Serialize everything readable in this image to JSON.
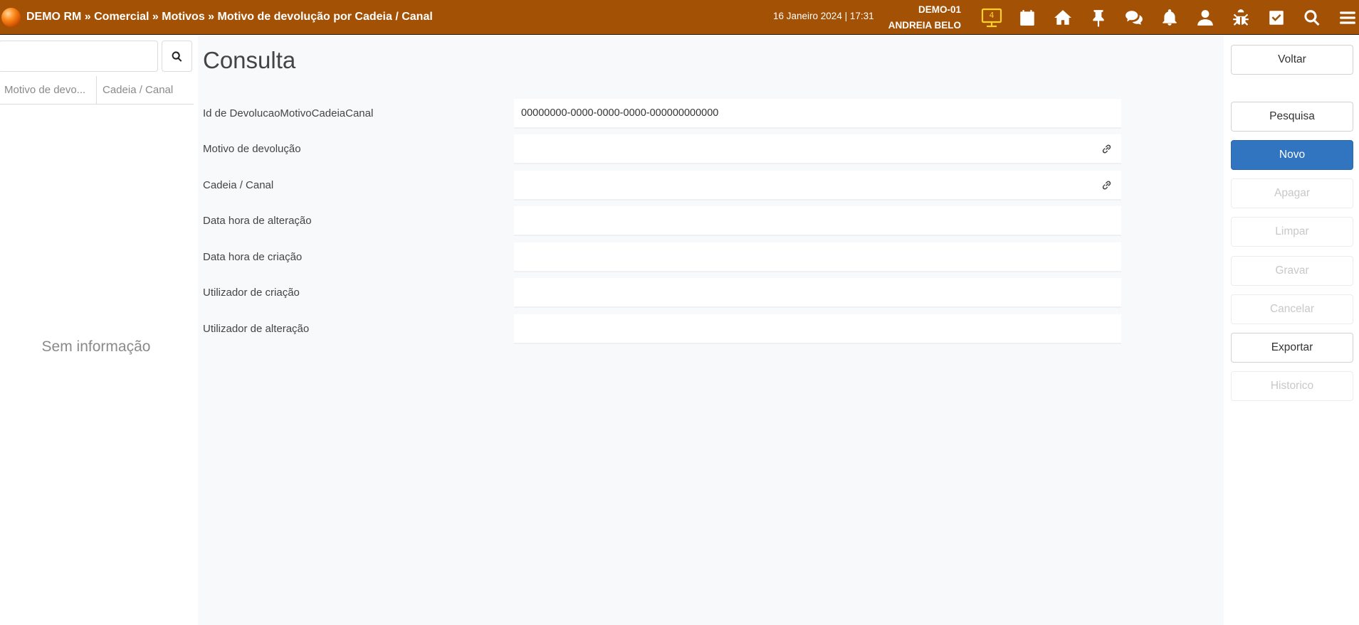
{
  "topbar": {
    "breadcrumb": "DEMO RM » Comercial » Motivos » Motivo de devolução por Cadeia / Canal",
    "datetime": "16 Janeiro 2024 | 17:31",
    "company": "DEMO-01",
    "user": "ANDREIA BELO",
    "monitor_count": "4",
    "icon_color_highlight": "#ffcf2e",
    "bar_color": "#a35104"
  },
  "left": {
    "columns": [
      "Motivo de devo...",
      "Cadeia / Canal"
    ],
    "empty_message": "Sem informação"
  },
  "main": {
    "title": "Consulta",
    "fields": [
      {
        "label": "Id de DevolucaoMotivoCadeiaCanal",
        "value": "00000000-0000-0000-0000-000000000000"
      },
      {
        "label": "Motivo de devolução",
        "value": ""
      },
      {
        "label": "Cadeia / Canal",
        "value": ""
      },
      {
        "label": "Data hora de alteração",
        "value": ""
      },
      {
        "label": "Data hora de criação",
        "value": ""
      },
      {
        "label": "Utilizador de criação",
        "value": ""
      },
      {
        "label": "Utilizador de alteração",
        "value": ""
      }
    ]
  },
  "actions": {
    "voltar": "Voltar",
    "pesquisa": "Pesquisa",
    "novo": "Novo",
    "apagar": "Apagar",
    "limpar": "Limpar",
    "gravar": "Gravar",
    "cancelar": "Cancelar",
    "exportar": "Exportar",
    "historico": "Historico",
    "primary_color": "#3174bf"
  }
}
